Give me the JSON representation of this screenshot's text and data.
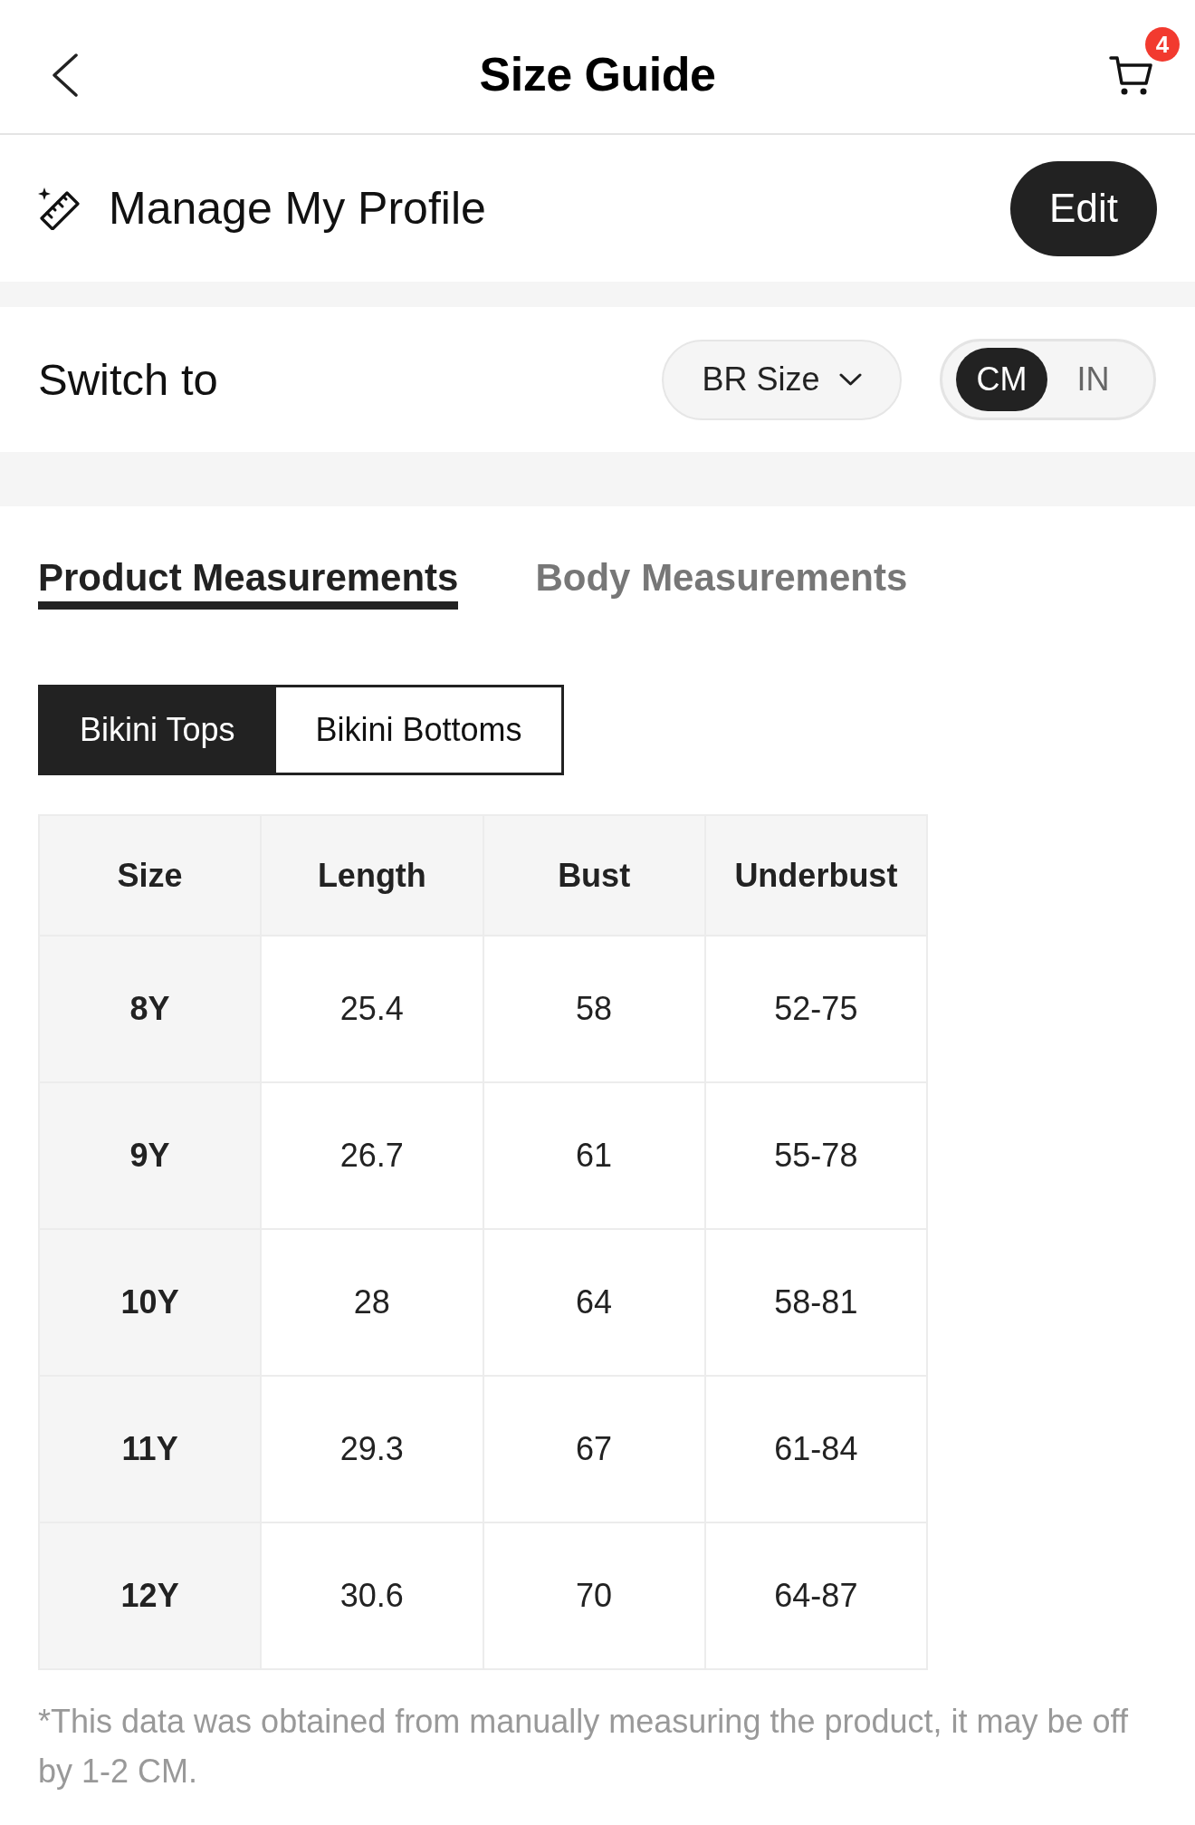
{
  "header": {
    "title": "Size Guide",
    "cart_badge": "4"
  },
  "profile": {
    "label": "Manage My Profile",
    "button": "Edit"
  },
  "switch": {
    "label": "Switch to",
    "size_system": "BR Size",
    "units": [
      {
        "label": "CM",
        "selected": true
      },
      {
        "label": "IN",
        "selected": false
      }
    ]
  },
  "tabs": [
    {
      "label": "Product Measurements",
      "selected": true
    },
    {
      "label": "Body Measurements",
      "selected": false
    }
  ],
  "categories": [
    {
      "label": "Bikini Tops",
      "selected": true
    },
    {
      "label": "Bikini Bottoms",
      "selected": false
    }
  ],
  "table": {
    "columns": [
      "Size",
      "Length",
      "Bust",
      "Underbust"
    ],
    "rows": [
      [
        "8Y",
        "25.4",
        "58",
        "52-75"
      ],
      [
        "9Y",
        "26.7",
        "61",
        "55-78"
      ],
      [
        "10Y",
        "28",
        "64",
        "58-81"
      ],
      [
        "11Y",
        "29.3",
        "67",
        "61-84"
      ],
      [
        "12Y",
        "30.6",
        "70",
        "64-87"
      ]
    ]
  },
  "note": "*This data was obtained from manually measuring the product, it may be off by 1-2 CM."
}
